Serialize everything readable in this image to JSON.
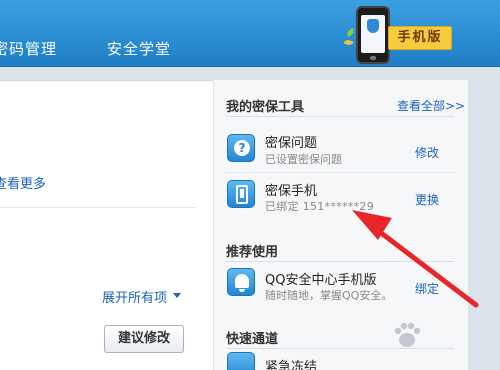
{
  "nav": {
    "items": [
      "密码管理",
      "安全学堂"
    ]
  },
  "mobile_badge": {
    "label": "手机版"
  },
  "left": {
    "see_more": "查看更多",
    "expand_all": "展开所有项",
    "suggest_btn": "建议修改"
  },
  "panel": {
    "tools_title": "我的密保工具",
    "view_all": "查看全部>>",
    "tools": [
      {
        "name": "密保问题",
        "desc": "已设置密保问题",
        "action": "修改",
        "icon": "question-icon"
      },
      {
        "name": "密保手机",
        "desc": "已绑定 151******29",
        "action": "更换",
        "icon": "phone-icon"
      }
    ],
    "recommend_title": "推荐使用",
    "recommend": [
      {
        "name": "QQ安全中心手机版",
        "desc": "随时随地，掌握QQ安全。",
        "action": "绑定",
        "icon": "bell-icon"
      }
    ],
    "quick_title": "快速通道",
    "quick": [
      {
        "name": "紧急冻结",
        "icon": "freeze-icon"
      }
    ]
  },
  "colors": {
    "nav_blue": "#2b8fd6",
    "link_blue": "#1c62b9",
    "arrow_red": "#e8262a",
    "badge_yellow": "#f6cc3d"
  }
}
